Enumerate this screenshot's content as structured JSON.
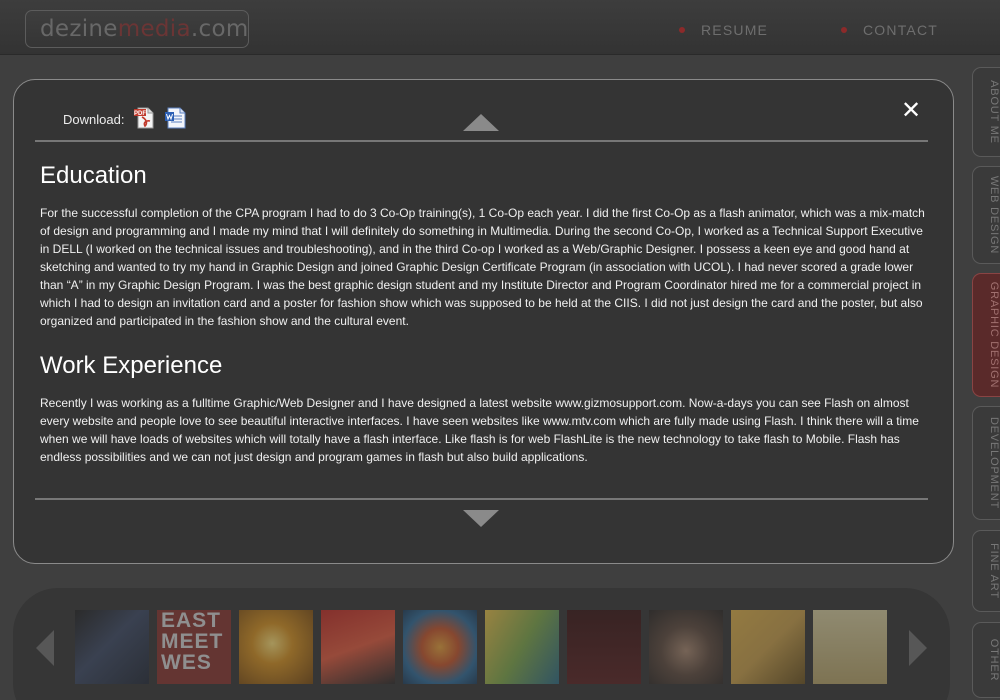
{
  "header": {
    "logo": {
      "part1": "dezine",
      "part2": "media",
      "part3": ".com"
    },
    "nav": [
      {
        "label": "RESUME"
      },
      {
        "label": "CONTACT"
      }
    ]
  },
  "side_tabs": [
    {
      "label": "ABOUT ME",
      "active": false
    },
    {
      "label": "WEB DESIGN",
      "active": false
    },
    {
      "label": "GRAPHIC DESIGN",
      "active": true
    },
    {
      "label": "DEVELOPMENT",
      "active": false
    },
    {
      "label": "FINE ART",
      "active": false
    },
    {
      "label": "OTHER",
      "active": false
    }
  ],
  "panel": {
    "download_label": "Download:",
    "pdf_badge": "PDF",
    "sections": [
      {
        "heading": "Education",
        "body": "For the successful completion of the CPA program I had to do 3 Co-Op training(s), 1 Co-Op each year. I did the first Co-Op as a flash animator, which was a mix-match of design and programming and I made my mind that I will definitely do something in Multimedia. During the second Co-Op, I worked as a Technical Support Executive in DELL (I worked on the technical issues and troubleshooting), and in the third Co-op I worked as a Web/Graphic Designer. I possess a keen eye and good hand at sketching and wanted to try my hand in Graphic Design and joined Graphic Design Certificate Program (in association with UCOL). I had never scored a grade lower than “A” in my Graphic Design Program. I was the best graphic design student and my Institute Director and Program Coordinator hired me for a commercial project in which I had to design an invitation card and a poster for fashion show which was supposed to be held at the CIIS. I did not just design the card and the poster, but also organized and participated in the fashion show and the cultural event."
      },
      {
        "heading": "Work Experience",
        "body": "Recently I was working as a fulltime Graphic/Web Designer and I have designed a latest website www.gizmosupport.com. Now-a-days you can see Flash on almost every website and people love to see beautiful interactive interfaces. I have seen websites like www.mtv.com which are fully made using Flash. I think there will a time when we will have loads of websites which will totally have a flash interface. Like flash is for web FlashLite is the new technology to take flash to Mobile. Flash has endless possibilities and we can not just design and program games in flash but also build applications."
      }
    ]
  },
  "gallery": {
    "thumb2_text": [
      "EAST",
      "MEET",
      "WES"
    ]
  },
  "colors": {
    "accent_red": "#8c2a2a",
    "active_tab_bg": "#5a2a2a",
    "panel_bg": "#343434",
    "page_bg": "#3f3f3f"
  },
  "icons": [
    "pdf-icon",
    "word-doc-icon",
    "close-icon",
    "scroll-up-icon",
    "scroll-down-icon",
    "arrow-left-icon",
    "arrow-right-icon"
  ]
}
